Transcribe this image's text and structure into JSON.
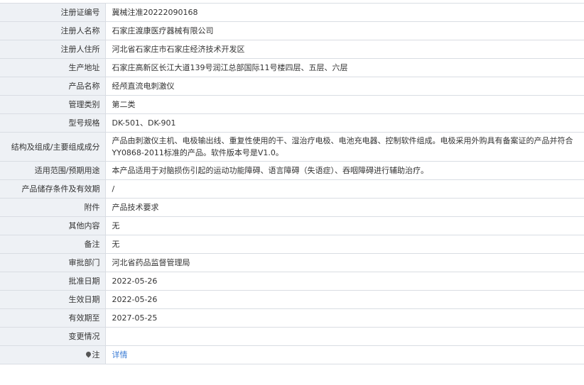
{
  "rows": [
    {
      "label": "注册证编号",
      "value": "冀械注准20222090168"
    },
    {
      "label": "注册人名称",
      "value": "石家庄渡康医疗器械有限公司"
    },
    {
      "label": "注册人住所",
      "value": "河北省石家庄市石家庄经济技术开发区"
    },
    {
      "label": "生产地址",
      "value": "石家庄高新区长江大道139号润江总部国际11号楼四层、五层、六层"
    },
    {
      "label": "产品名称",
      "value": "经颅直流电刺激仪"
    },
    {
      "label": "管理类别",
      "value": "第二类"
    },
    {
      "label": "型号规格",
      "value": "DK-501、DK-901"
    },
    {
      "label": "结构及组成/主要组成成分",
      "value": "产品由刺激仪主机、电极输出线、重复性使用的干、湿治疗电极、电池充电器、控制软件组成。电极采用外购具有备案证的产品并符合YY0868-2011标准的产品。软件版本号是V1.0。"
    },
    {
      "label": "适用范围/预期用途",
      "value": "本产品适用于对脑损伤引起的运动功能障碍、语言障碍（失语症）、吞咽障碍进行辅助治疗。"
    },
    {
      "label": "产品储存条件及有效期",
      "value": "/"
    },
    {
      "label": "附件",
      "value": "产品技术要求"
    },
    {
      "label": "其他内容",
      "value": "无"
    },
    {
      "label": "备注",
      "value": "无"
    },
    {
      "label": "审批部门",
      "value": "河北省药品监督管理局"
    },
    {
      "label": "批准日期",
      "value": "2022-05-26"
    },
    {
      "label": "生效日期",
      "value": "2022-05-26"
    },
    {
      "label": "有效期至",
      "value": "2027-05-25"
    },
    {
      "label": "变更情况",
      "value": ""
    }
  ],
  "note": {
    "label": "注",
    "icon": "map-pin-icon",
    "link_text": "详情"
  }
}
